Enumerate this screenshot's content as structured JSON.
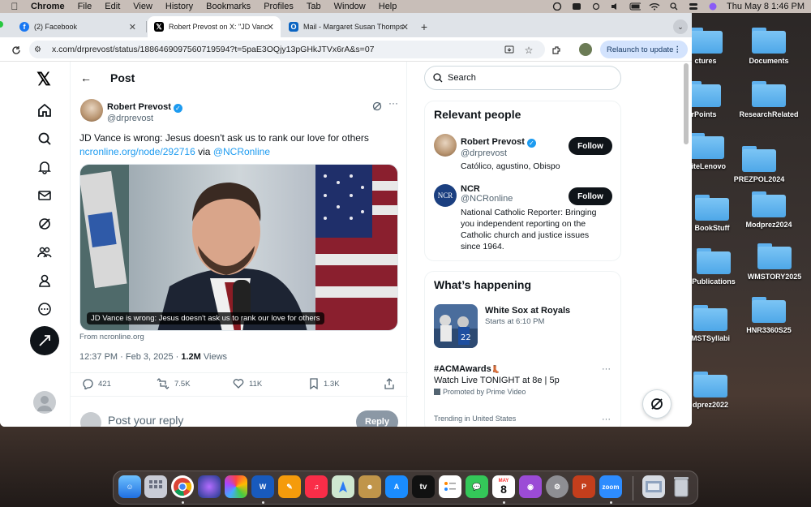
{
  "menubar": {
    "app": "Chrome",
    "items": [
      "File",
      "Edit",
      "View",
      "History",
      "Bookmarks",
      "Profiles",
      "Tab",
      "Window",
      "Help"
    ],
    "clock": "Thu May 8  1:46 PM"
  },
  "desktop": {
    "folders": [
      "ctures",
      "Documents",
      "rPoints",
      "ResearchRelated",
      "riteLenovo",
      "PREZPOL2024",
      "Modprez2024",
      "BookStuff",
      "WMSTORY2025",
      "Publications",
      "HNR3360S25",
      "MSTSyllabi",
      "dprez2022"
    ]
  },
  "browser": {
    "tabs": [
      {
        "title": "(2) Facebook"
      },
      {
        "title": "Robert Prevost on X: \"JD Vanc"
      },
      {
        "title": "Mail - Margaret Susan Thomps"
      }
    ],
    "url": "x.com/drprevost/status/1886469097560719594?t=5paE3OQjy13pGHkJTVx6rA&s=07",
    "relaunch": "Relaunch to update"
  },
  "post": {
    "header": "Post",
    "author_name": "Robert Prevost",
    "author_handle": "@drprevost",
    "text": "JD Vance is wrong: Jesus doesn't ask us to rank our love for others",
    "link": "ncronline.org/node/292716",
    "via": "via",
    "via_handle": "@NCRonline",
    "image_caption": "JD Vance is wrong: Jesus doesn't ask us to rank our love for others",
    "from": "From ncronline.org",
    "timestamp": "12:37 PM · Feb 3, 2025 · ",
    "views_count": "1.2M",
    "views_label": " Views",
    "replies": "421",
    "reposts": "7.5K",
    "likes": "11K",
    "bookmarks": "1.3K",
    "reply_placeholder": "Post your reply",
    "reply_button": "Reply"
  },
  "search": {
    "placeholder": "Search"
  },
  "relevant": {
    "title": "Relevant people",
    "people": [
      {
        "name": "Robert Prevost",
        "handle": "@drprevost",
        "bio": "Católico, agustino, Obispo",
        "follow": "Follow"
      },
      {
        "name": "NCR",
        "handle": "@NCRonline",
        "bio": "National Catholic Reporter: Bringing you independent reporting on the Catholic church and justice issues since 1964.",
        "follow": "Follow",
        "avatar_text": "NCR"
      }
    ]
  },
  "happening": {
    "title": "What’s happening",
    "event_title": "White Sox at Royals",
    "event_time": "Starts at 6:10 PM",
    "trend_tag": "#ACMAwards",
    "trend_desc": "Watch Live TONIGHT at 8e | 5p",
    "promoted": "Promoted by Prime Video",
    "trending_in": "Trending in United States"
  },
  "dock": {
    "calendar_month": "MAY",
    "calendar_day": "8",
    "tv_label": "tv",
    "zoom_label": "zoom"
  },
  "colors": {
    "accent": "#1d9bf0",
    "text": "#0f1419",
    "muted": "#536471"
  }
}
